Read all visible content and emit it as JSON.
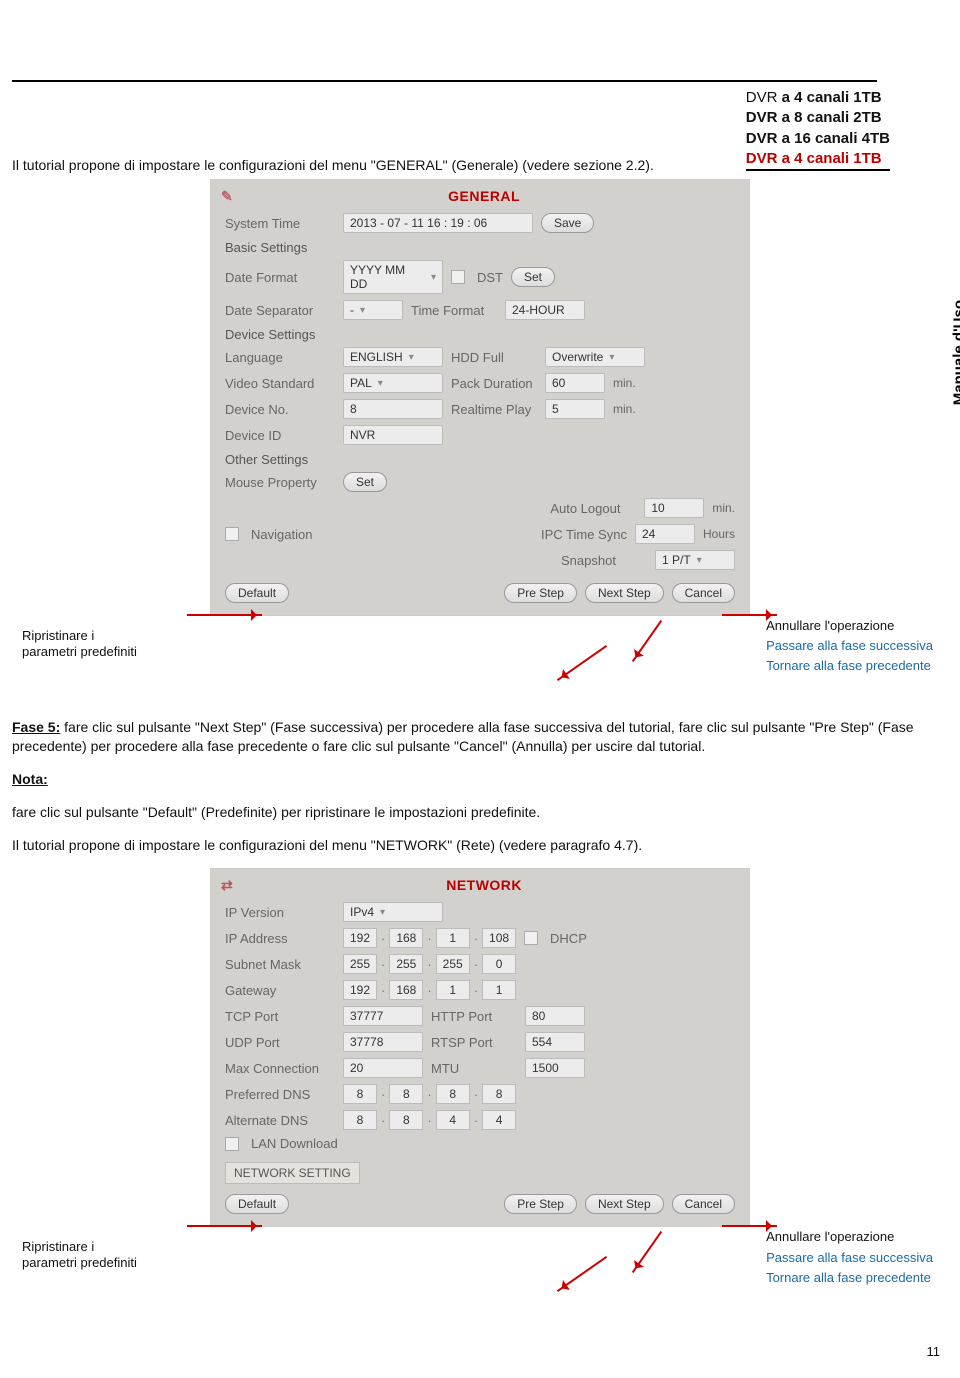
{
  "header": {
    "l1_a": "DVR ",
    "l1_b": "a 4 canali 1TB",
    "l2_a": "DVR ",
    "l2_b": "a 8 canali 2TB",
    "l3_a": "DVR ",
    "l3_b": "a 16 canali 4TB",
    "l4_a": "DVR ",
    "l4_b": "a 4 canali 1TB"
  },
  "side_label": "Manuale d'Uso",
  "intro1": "Il tutorial propone di impostare le configurazioni del menu \"GENERAL\" (Generale) (vedere sezione 2.2).",
  "general": {
    "title": "GENERAL",
    "icon": "✎",
    "rows": {
      "system_time_l": "System Time",
      "system_time_v": "2013 - 07 - 11  16 : 19 : 06",
      "save": "Save",
      "basic": "Basic Settings",
      "date_format_l": "Date Format",
      "date_format_v": "YYYY MM DD",
      "dst": "DST",
      "set": "Set",
      "date_sep_l": "Date Separator",
      "date_sep_v": "-",
      "time_format_l": "Time Format",
      "time_format_v": "24-HOUR",
      "device": "Device Settings",
      "language_l": "Language",
      "language_v": "ENGLISH",
      "hdd_l": "HDD Full",
      "hdd_v": "Overwrite",
      "vstd_l": "Video Standard",
      "vstd_v": "PAL",
      "pack_l": "Pack Duration",
      "pack_v": "60",
      "pack_u": "min.",
      "devno_l": "Device No.",
      "devno_v": "8",
      "rt_l": "Realtime Play",
      "rt_v": "5",
      "rt_u": "min.",
      "devid_l": "Device ID",
      "devid_v": "NVR",
      "other": "Other Settings",
      "mouse_l": "Mouse Property",
      "mouse_set": "Set",
      "auto_l": "Auto Logout",
      "auto_v": "10",
      "auto_u": "min.",
      "nav": "Navigation",
      "ipc_l": "IPC Time Sync",
      "ipc_v": "24",
      "ipc_u": "Hours",
      "snap_l": "Snapshot",
      "snap_v": "1 P/T"
    },
    "foot": {
      "default": "Default",
      "pre": "Pre Step",
      "next": "Next Step",
      "cancel": "Cancel"
    }
  },
  "callout": {
    "left1": "Ripristinare i",
    "left2": "parametri predefiniti",
    "r1": "Annullare l'operazione",
    "r2": "Passare alla fase successiva",
    "r3": "Tornare alla fase precedente"
  },
  "fase5_label": "Fase 5:",
  "fase5_text": " fare clic sul pulsante \"Next Step\" (Fase successiva) per procedere alla fase successiva del tutorial, fare clic sul pulsante \"Pre Step\" (Fase precedente) per procedere alla fase precedente o fare clic sul pulsante \"Cancel\" (Annulla) per uscire dal tutorial.",
  "nota": "Nota:",
  "nota_text": "fare clic sul pulsante \"Default\" (Predefinite) per ripristinare le impostazioni predefinite.",
  "intro2": "Il tutorial propone di impostare le configurazioni del menu \"NETWORK\" (Rete) (vedere paragrafo 4.7).",
  "network": {
    "title": "NETWORK",
    "icon": "⇄",
    "ipver_l": "IP Version",
    "ipver_v": "IPv4",
    "ipaddr_l": "IP Address",
    "ipaddr": [
      "192",
      "168",
      "1",
      "108"
    ],
    "dhcp": "DHCP",
    "subnet_l": "Subnet Mask",
    "subnet": [
      "255",
      "255",
      "255",
      "0"
    ],
    "gw_l": "Gateway",
    "gw": [
      "192",
      "168",
      "1",
      "1"
    ],
    "tcp_l": "TCP Port",
    "tcp_v": "37777",
    "http_l": "HTTP Port",
    "http_v": "80",
    "udp_l": "UDP Port",
    "udp_v": "37778",
    "rtsp_l": "RTSP Port",
    "rtsp_v": "554",
    "max_l": "Max Connection",
    "max_v": "20",
    "mtu_l": "MTU",
    "mtu_v": "1500",
    "pdns_l": "Preferred DNS",
    "pdns": [
      "8",
      "8",
      "8",
      "8"
    ],
    "adns_l": "Alternate DNS",
    "adns": [
      "8",
      "8",
      "4",
      "4"
    ],
    "lan": "LAN Download",
    "setting": "NETWORK SETTING",
    "foot": {
      "default": "Default",
      "pre": "Pre Step",
      "next": "Next Step",
      "cancel": "Cancel"
    }
  },
  "page_num": "11"
}
